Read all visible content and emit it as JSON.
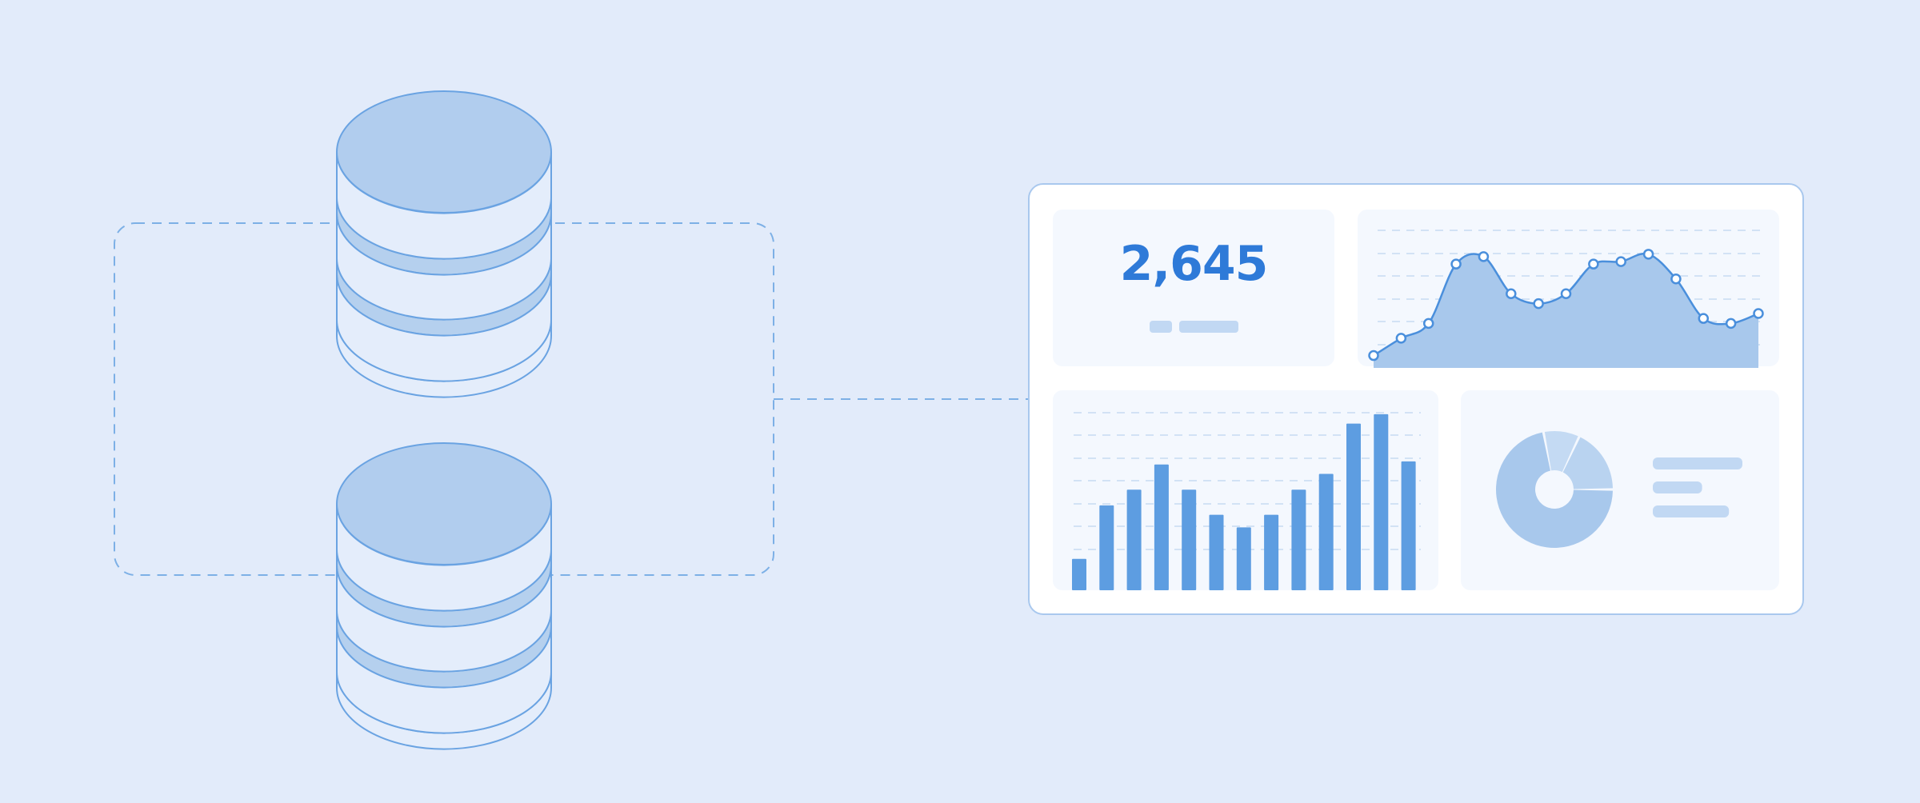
{
  "colors": {
    "background": "#e2ebfa",
    "accent": "#2e7ad8",
    "stroke": "#6aa3e2",
    "fill_light": "#b5d0ee",
    "fill_medium": "#a8c8ec",
    "bar": "#5d9de1",
    "panel": "#f4f8fe",
    "card": "#ffffff"
  },
  "databases": [
    {
      "name": "database-top"
    },
    {
      "name": "database-bottom"
    }
  ],
  "dashboard": {
    "kpi": {
      "value": "2,645"
    },
    "line_chart": {
      "type": "area",
      "values": [
        5,
        12,
        18,
        42,
        45,
        30,
        26,
        30,
        42,
        43,
        46,
        36,
        20,
        18,
        22
      ]
    },
    "bar_chart": {
      "type": "bar",
      "values": [
        10,
        27,
        32,
        40,
        32,
        24,
        20,
        24,
        32,
        37,
        53,
        56,
        41
      ]
    },
    "donut_chart": {
      "type": "pie",
      "segments": [
        {
          "value": 72,
          "color": "#a8c8ec"
        },
        {
          "value": 10,
          "color": "#c4daf3"
        },
        {
          "value": 18,
          "color": "#b9d3f0"
        }
      ]
    },
    "legend_lines": [
      {
        "fraction": 1.0
      },
      {
        "fraction": 0.55
      },
      {
        "fraction": 0.85
      }
    ]
  }
}
